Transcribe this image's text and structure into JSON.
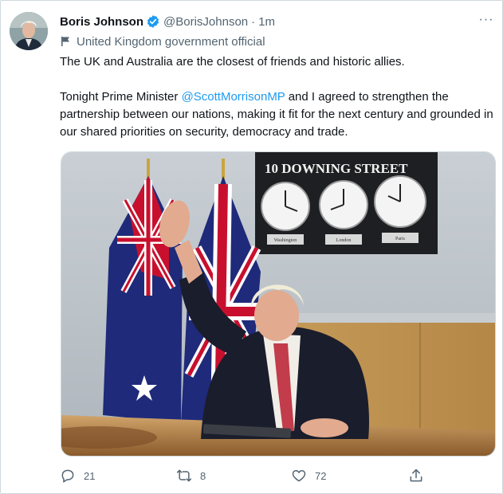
{
  "tweet": {
    "author_name": "Boris Johnson",
    "handle": "@BorisJohnson",
    "separator": "·",
    "time": "1m",
    "affiliation": "United Kingdom government official",
    "text_line1": "The UK and Australia are the closest of friends and historic allies.",
    "text_p2_before": "Tonight Prime Minister ",
    "mention": "@ScottMorrisonMP",
    "text_p2_after": " and I agreed to strengthen the partnership between our nations, making it fit for the next century and grounded in our shared priorities on security, democracy and trade.",
    "more_label": "···"
  },
  "media": {
    "sign_text": "10 DOWNING STREET",
    "clock_labels": [
      "Washington",
      "London",
      "Paris"
    ]
  },
  "actions": {
    "replies": "21",
    "retweets": "8",
    "likes": "72"
  },
  "colors": {
    "accent": "#1d9bf0",
    "secondary_text": "#536471",
    "primary_text": "#0f1419"
  }
}
